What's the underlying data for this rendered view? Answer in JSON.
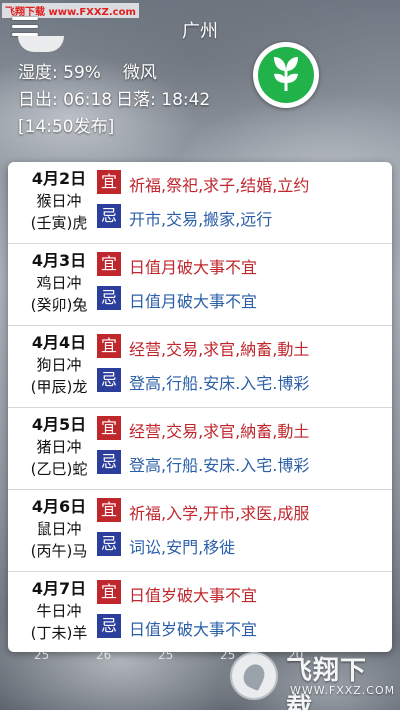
{
  "watermark_top": "飞翔下载 www.FXXZ.com",
  "header": {
    "city": "广州",
    "menu_icon": "hamburger-menu-icon"
  },
  "weather": {
    "humidity": "湿度: 59%",
    "wind": "微风",
    "sunrise": "日出: 06:18",
    "sunset": "日落: 18:42",
    "publish": "[14:50发布]",
    "action_icon": "leaf-icon"
  },
  "almanac": {
    "yi_label": "宜",
    "ji_label": "忌",
    "days": [
      {
        "date": "4月2日",
        "clash": "猴日冲",
        "ganzhi": "(壬寅)虎",
        "good": "祈福,祭祀,求子,结婚,立约",
        "bad": "开市,交易,搬家,远行"
      },
      {
        "date": "4月3日",
        "clash": "鸡日冲",
        "ganzhi": "(癸卯)兔",
        "good": "日值月破大事不宜",
        "bad": "日值月破大事不宜"
      },
      {
        "date": "4月4日",
        "clash": "狗日冲",
        "ganzhi": "(甲辰)龙",
        "good": "经营,交易,求官,納畜,動土",
        "bad": "登高,行船.安床.入宅.博彩"
      },
      {
        "date": "4月5日",
        "clash": "猪日冲",
        "ganzhi": "(乙巳)蛇",
        "good": "经营,交易,求官,納畜,動土",
        "bad": "登高,行船.安床.入宅.博彩"
      },
      {
        "date": "4月6日",
        "clash": "鼠日冲",
        "ganzhi": "(丙午)马",
        "good": "祈福,入学,开市,求医,成服",
        "bad": "词讼,安門,移徙"
      },
      {
        "date": "4月7日",
        "clash": "牛日冲",
        "ganzhi": "(丁未)羊",
        "good": "日值岁破大事不宜",
        "bad": "日值岁破大事不宜"
      }
    ]
  },
  "bottom_numbers": [
    "25",
    "26",
    "25",
    "25",
    "20"
  ],
  "logo": {
    "name": "飞翔下载",
    "url": "WWW.FXXZ.COM"
  }
}
